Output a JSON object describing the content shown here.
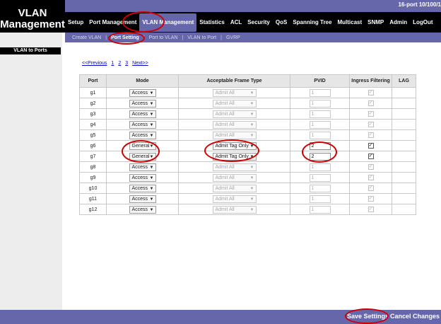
{
  "app": {
    "title": "VLAN Management",
    "model": "16-port 10/100/1"
  },
  "nav": {
    "items": [
      {
        "label": "Setup",
        "active": false
      },
      {
        "label": "Port Management",
        "active": false
      },
      {
        "label": "VLAN Management",
        "active": true
      },
      {
        "label": "Statistics",
        "active": false
      },
      {
        "label": "ACL",
        "active": false
      },
      {
        "label": "Security",
        "active": false
      },
      {
        "label": "QoS",
        "active": false
      },
      {
        "label": "Spanning Tree",
        "active": false
      },
      {
        "label": "Multicast",
        "active": false
      },
      {
        "label": "SNMP",
        "active": false
      },
      {
        "label": "Admin",
        "active": false
      },
      {
        "label": "LogOut",
        "active": false
      }
    ]
  },
  "subnav": {
    "items": [
      {
        "label": "Create VLAN",
        "active": false
      },
      {
        "label": "Port Setting",
        "active": true
      },
      {
        "label": "Port to VLAN",
        "active": false
      },
      {
        "label": "VLAN to Port",
        "active": false
      },
      {
        "label": "GVRP",
        "active": false
      }
    ]
  },
  "sidebar": {
    "title": "VLAN to Ports"
  },
  "pager": {
    "prev": "<<Previous",
    "pages": [
      "1",
      "2",
      "3"
    ],
    "next": "Next>>"
  },
  "table": {
    "headers": [
      "Port",
      "Mode",
      "Acceptable Frame Type",
      "PVID",
      "Ingress Filtering",
      "LAG"
    ],
    "rows": [
      {
        "port": "g1",
        "mode": "Access",
        "frame": "Admit All",
        "pvid": "1",
        "ingress": true,
        "editable": false
      },
      {
        "port": "g2",
        "mode": "Access",
        "frame": "Admit All",
        "pvid": "1",
        "ingress": true,
        "editable": false
      },
      {
        "port": "g3",
        "mode": "Access",
        "frame": "Admit All",
        "pvid": "1",
        "ingress": true,
        "editable": false
      },
      {
        "port": "g4",
        "mode": "Access",
        "frame": "Admit All",
        "pvid": "1",
        "ingress": true,
        "editable": false
      },
      {
        "port": "g5",
        "mode": "Access",
        "frame": "Admit All",
        "pvid": "1",
        "ingress": true,
        "editable": false
      },
      {
        "port": "g6",
        "mode": "General",
        "frame": "Admit Tag Only",
        "pvid": "2",
        "ingress": true,
        "editable": true
      },
      {
        "port": "g7",
        "mode": "General",
        "frame": "Admit Tag Only",
        "pvid": "2",
        "ingress": true,
        "editable": true
      },
      {
        "port": "g8",
        "mode": "Access",
        "frame": "Admit All",
        "pvid": "1",
        "ingress": true,
        "editable": false
      },
      {
        "port": "g9",
        "mode": "Access",
        "frame": "Admit All",
        "pvid": "1",
        "ingress": true,
        "editable": false
      },
      {
        "port": "g10",
        "mode": "Access",
        "frame": "Admit All",
        "pvid": "1",
        "ingress": true,
        "editable": false
      },
      {
        "port": "g11",
        "mode": "Access",
        "frame": "Admit All",
        "pvid": "1",
        "ingress": true,
        "editable": false
      },
      {
        "port": "g12",
        "mode": "Access",
        "frame": "Admit All",
        "pvid": "1",
        "ingress": true,
        "editable": false
      }
    ]
  },
  "footer": {
    "save_label": "Save Settings",
    "cancel_label": "Cancel Changes"
  },
  "colors": {
    "accent": "#6666aa",
    "highlight": "#d00000",
    "link": "#0000cc"
  }
}
